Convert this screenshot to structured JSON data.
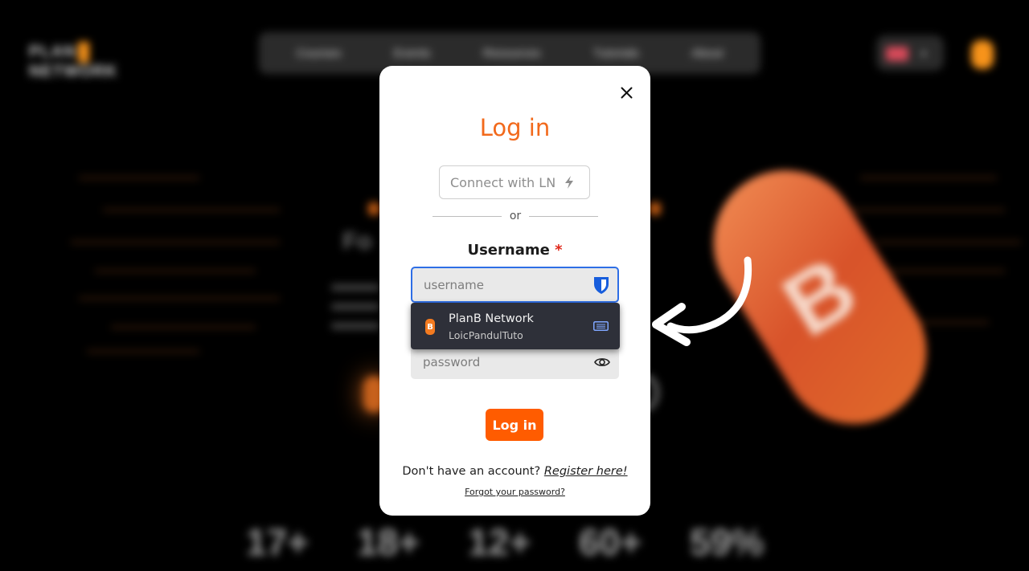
{
  "background": {
    "nav_items": [
      "Courses",
      "Events",
      "Resources",
      "Tutorials",
      "About"
    ]
  },
  "modal": {
    "title": "Log in",
    "ln_button_label": "Connect with LN",
    "divider_text": "or",
    "username_label": "Username",
    "required_marker": "*",
    "username_placeholder": "username",
    "password_placeholder": "password",
    "login_button_label": "Log in",
    "no_account_text": "Don't have an account?",
    "register_link": "Register here!",
    "forgot_link": "Forgot your password?"
  },
  "autofill": {
    "site_name": "PlanB Network",
    "username": "LoicPandulTuto",
    "favicon_letter": "B"
  },
  "colors": {
    "accent": "#ff5c00",
    "title": "#f2691b",
    "focus_border": "#2e6ee6",
    "autofill_bg": "#2e3039"
  }
}
